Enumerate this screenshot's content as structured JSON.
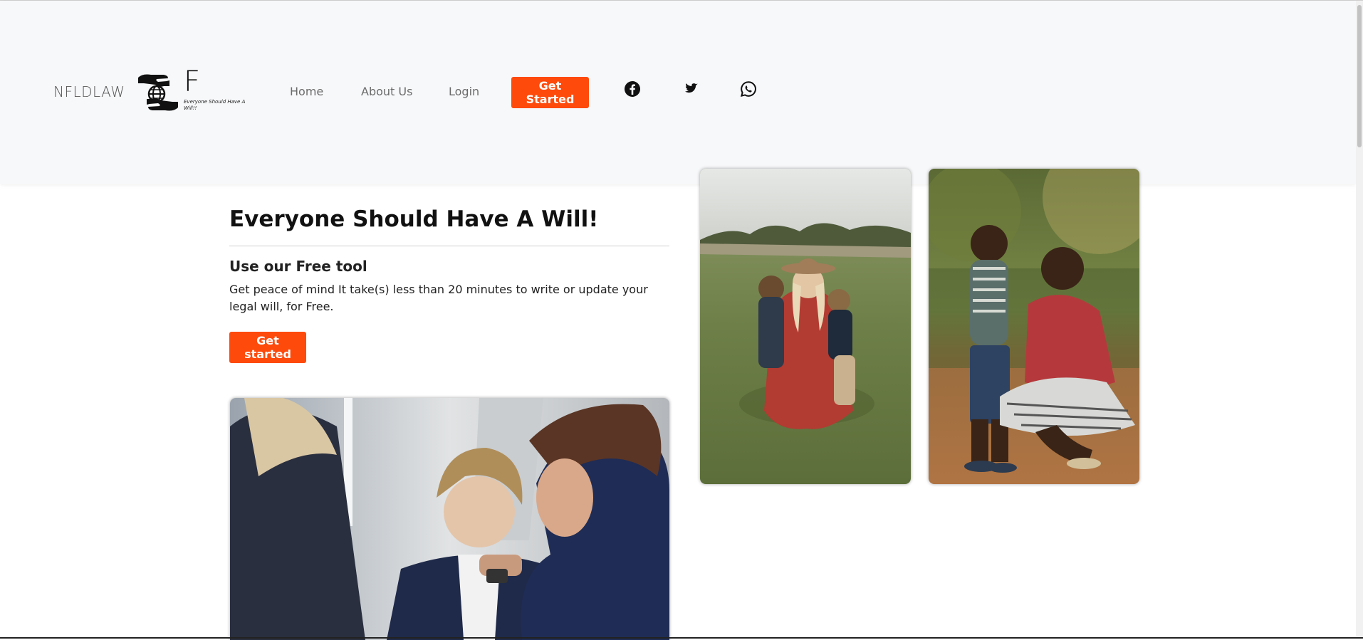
{
  "header": {
    "brand": "NFLDLAW",
    "logo_letter": "F",
    "logo_tagline": "Everyone Should Have A Will!!",
    "nav": [
      {
        "label": "Home"
      },
      {
        "label": "About Us"
      },
      {
        "label": "Login"
      }
    ],
    "cta_label": "Get Started",
    "social": [
      "facebook-icon",
      "twitter-icon",
      "whatsapp-icon"
    ],
    "accent_color": "#fe4a0b"
  },
  "hero": {
    "title": "Everyone Should Have A Will!",
    "subtitle": "Use our Free tool",
    "description": "Get peace of mind It take(s) less than 20 minutes to write or update your legal will, for Free.",
    "button_label": "Get started"
  },
  "photos": [
    {
      "name": "meeting-photo"
    },
    {
      "name": "mother-children-photo"
    },
    {
      "name": "mother-son-photo"
    }
  ]
}
